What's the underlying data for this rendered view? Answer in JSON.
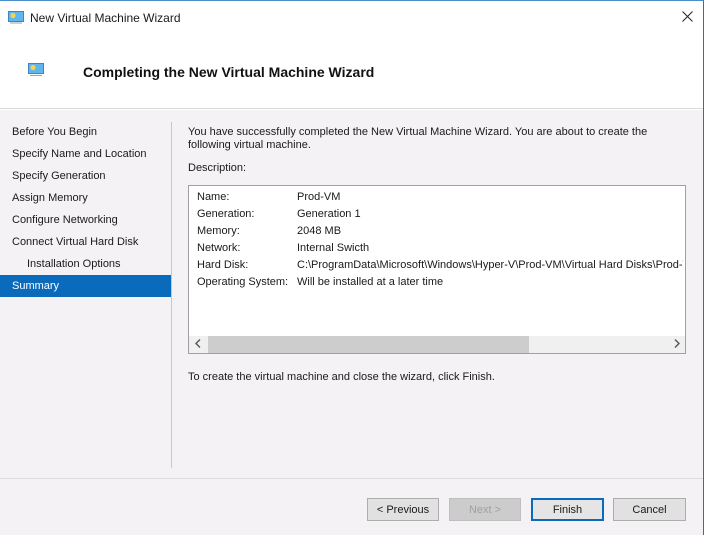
{
  "window": {
    "title": "New Virtual Machine Wizard",
    "title_icon": "virtual-machine-icon",
    "close_icon": "close-icon"
  },
  "header": {
    "title": "Completing the New Virtual Machine Wizard",
    "icon": "virtual-machine-icon"
  },
  "nav": {
    "items": [
      {
        "label": "Before You Begin",
        "indent": false,
        "selected": false
      },
      {
        "label": "Specify Name and Location",
        "indent": false,
        "selected": false
      },
      {
        "label": "Specify Generation",
        "indent": false,
        "selected": false
      },
      {
        "label": "Assign Memory",
        "indent": false,
        "selected": false
      },
      {
        "label": "Configure Networking",
        "indent": false,
        "selected": false
      },
      {
        "label": "Connect Virtual Hard Disk",
        "indent": false,
        "selected": false
      },
      {
        "label": "Installation Options",
        "indent": true,
        "selected": false
      },
      {
        "label": "Summary",
        "indent": false,
        "selected": true
      }
    ]
  },
  "content": {
    "intro": "You have successfully completed the New Virtual Machine Wizard. You are about to create the following virtual machine.",
    "description_label": "Description:",
    "description": [
      {
        "key": "Name:",
        "value": "Prod-VM"
      },
      {
        "key": "Generation:",
        "value": "Generation 1"
      },
      {
        "key": "Memory:",
        "value": "2048 MB"
      },
      {
        "key": "Network:",
        "value": "Internal Swicth"
      },
      {
        "key": "Hard Disk:",
        "value": "C:\\ProgramData\\Microsoft\\Windows\\Hyper-V\\Prod-VM\\Virtual Hard Disks\\Prod-VM.vhdx"
      },
      {
        "key": "Operating System:",
        "value": "Will be installed at a later time"
      }
    ],
    "scrollbar": {
      "left_arrow": "<",
      "right_arrow": ">",
      "thumb_fraction": 0.7,
      "position_fraction": 0
    },
    "finish_note": "To create the virtual machine and close the wizard, click Finish."
  },
  "footer": {
    "previous_label": "< Previous",
    "next_label": "Next >",
    "finish_label": "Finish",
    "cancel_label": "Cancel",
    "next_disabled": true
  },
  "colors": {
    "accent": "#0a6bbd",
    "panel_bg": "#f4f2f5",
    "selected_text": "#ffffff"
  }
}
